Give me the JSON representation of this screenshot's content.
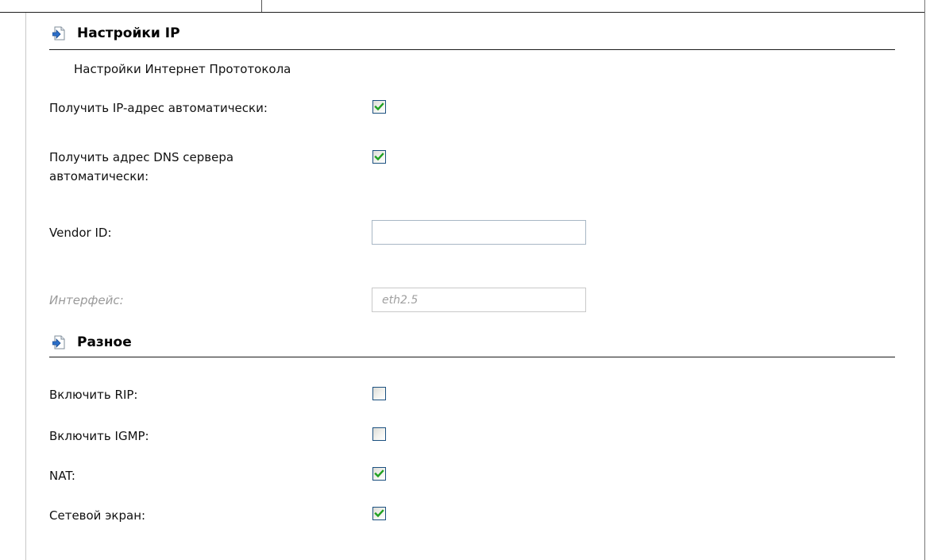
{
  "ip_section": {
    "title": "Настройки IP",
    "subtitle": "Настройки Интернет Прототокола",
    "fields": {
      "auto_ip": {
        "label": "Получить IP-адрес автоматически:",
        "checked": true
      },
      "auto_dns": {
        "label_line1": "Получить адрес DNS сервера",
        "label_line2": "автоматически:",
        "checked": true
      },
      "vendor_id": {
        "label": "Vendor ID:",
        "value": ""
      },
      "interface": {
        "label": "Интерфейс:",
        "value": "eth2.5",
        "disabled": true
      }
    }
  },
  "misc_section": {
    "title": "Разное",
    "fields": {
      "rip": {
        "label": "Включить RIP:",
        "checked": false
      },
      "igmp": {
        "label": "Включить IGMP:",
        "checked": false
      },
      "nat": {
        "label": "NAT:",
        "checked": true
      },
      "firewall": {
        "label": "Сетевой экран:",
        "checked": true
      }
    }
  },
  "colors": {
    "checkmark": "#21a121",
    "checkbox_border": "#1c5180",
    "icon_arrow": "#2c6fc9"
  }
}
